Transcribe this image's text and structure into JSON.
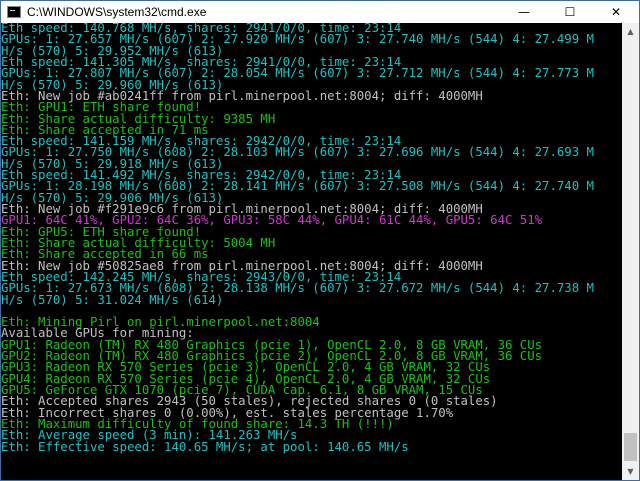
{
  "window": {
    "title": "C:\\WINDOWS\\system32\\cmd.exe",
    "minimize_glyph": "—",
    "maximize_glyph": "☐",
    "close_glyph": "✕"
  },
  "console_lines": [
    {
      "color": "c",
      "text": "Eth speed: 140.768 MH/s, shares: 2941/0/0, time: 23:14"
    },
    {
      "color": "c",
      "text": "GPUs: 1: 27.657 MH/s (607) 2: 27.920 MH/s (607) 3: 27.740 MH/s (544) 4: 27.499 M"
    },
    {
      "color": "c",
      "text": "H/s (570) 5: 29.952 MH/s (613)"
    },
    {
      "color": "c",
      "text": "Eth speed: 141.305 MH/s, shares: 2941/0/0, time: 23:14"
    },
    {
      "color": "c",
      "text": "GPUs: 1: 27.807 MH/s (607) 2: 28.054 MH/s (607) 3: 27.712 MH/s (544) 4: 27.773 M"
    },
    {
      "color": "c",
      "text": "H/s (570) 5: 29.960 MH/s (613)"
    },
    {
      "color": "w",
      "text": "Eth: New job #ab0241ff from pirl.minerpool.net:8004; diff: 4000MH"
    },
    {
      "color": "g",
      "text": "Eth: GPU1: ETH share found!"
    },
    {
      "color": "g",
      "text": "Eth: Share actual difficulty: 9385 MH"
    },
    {
      "color": "g",
      "text": "Eth: Share accepted in 71 ms"
    },
    {
      "color": "c",
      "text": "Eth speed: 141.159 MH/s, shares: 2942/0/0, time: 23:14"
    },
    {
      "color": "c",
      "text": "GPUs: 1: 27.750 MH/s (608) 2: 28.103 MH/s (607) 3: 27.696 MH/s (544) 4: 27.693 M"
    },
    {
      "color": "c",
      "text": "H/s (570) 5: 29.918 MH/s (613)"
    },
    {
      "color": "c",
      "text": "Eth speed: 141.492 MH/s, shares: 2942/0/0, time: 23:14"
    },
    {
      "color": "c",
      "text": "GPUs: 1: 28.198 MH/s (608) 2: 28.141 MH/s (607) 3: 27.508 MH/s (544) 4: 27.740 M"
    },
    {
      "color": "c",
      "text": "H/s (570) 5: 29.906 MH/s (613)"
    },
    {
      "color": "w",
      "text": "Eth: New job #f291e9c6 from pirl.minerpool.net:8004; diff: 4000MH"
    },
    {
      "color": "m",
      "text": "GPU1: 64C 41%, GPU2: 64C 36%, GPU3: 58C 44%, GPU4: 61C 44%, GPU5: 64C 51%"
    },
    {
      "color": "g",
      "text": "Eth: GPU5: ETH share found!"
    },
    {
      "color": "g",
      "text": "Eth: Share actual difficulty: 5004 MH"
    },
    {
      "color": "g",
      "text": "Eth: Share accepted in 66 ms"
    },
    {
      "color": "w",
      "text": "Eth: New job #50825ae8 from pirl.minerpool.net:8004; diff: 4000MH"
    },
    {
      "color": "c",
      "text": "Eth speed: 142.245 MH/s, shares: 2943/0/0, time: 23:14"
    },
    {
      "color": "c",
      "text": "GPUs: 1: 27.673 MH/s (608) 2: 28.138 MH/s (607) 3: 27.672 MH/s (544) 4: 27.738 M"
    },
    {
      "color": "c",
      "text": "H/s (570) 5: 31.024 MH/s (614)"
    },
    {
      "color": "c",
      "text": ""
    },
    {
      "color": "g",
      "text": "Eth: Mining Pirl on pirl.minerpool.net:8004"
    },
    {
      "color": "w",
      "text": "Available GPUs for mining:"
    },
    {
      "color": "g",
      "text": "GPU1: Radeon (TM) RX 480 Graphics (pcie 1), OpenCL 2.0, 8 GB VRAM, 36 CUs"
    },
    {
      "color": "g",
      "text": "GPU2: Radeon (TM) RX 480 Graphics (pcie 2), OpenCL 2.0, 8 GB VRAM, 36 CUs"
    },
    {
      "color": "g",
      "text": "GPU3: Radeon RX 570 Series (pcie 3), OpenCL 2.0, 4 GB VRAM, 32 CUs"
    },
    {
      "color": "g",
      "text": "GPU4: Radeon RX 570 Series (pcie 4), OpenCL 2.0, 4 GB VRAM, 32 CUs"
    },
    {
      "color": "g",
      "text": "GPU5: GeForce GTX 1070 (pcie 7), CUDA cap. 6.1, 8 GB VRAM, 15 CUs"
    },
    {
      "color": "w",
      "text": "Eth: Accepted shares 2943 (50 stales), rejected shares 0 (0 stales)"
    },
    {
      "color": "w",
      "text": "Eth: Incorrect shares 0 (0.00%), est. stales percentage 1.70%"
    },
    {
      "color": "g",
      "text": "Eth: Maximum difficulty of found share: 14.3 TH (!!!)"
    },
    {
      "color": "c",
      "text": "Eth: Average speed (3 min): 141.263 MH/s"
    },
    {
      "color": "c",
      "text": "Eth: Effective speed: 140.65 MH/s; at pool: 140.65 MH/s"
    }
  ],
  "scrollbar": {
    "up_glyph": "▲",
    "down_glyph": "▼"
  }
}
